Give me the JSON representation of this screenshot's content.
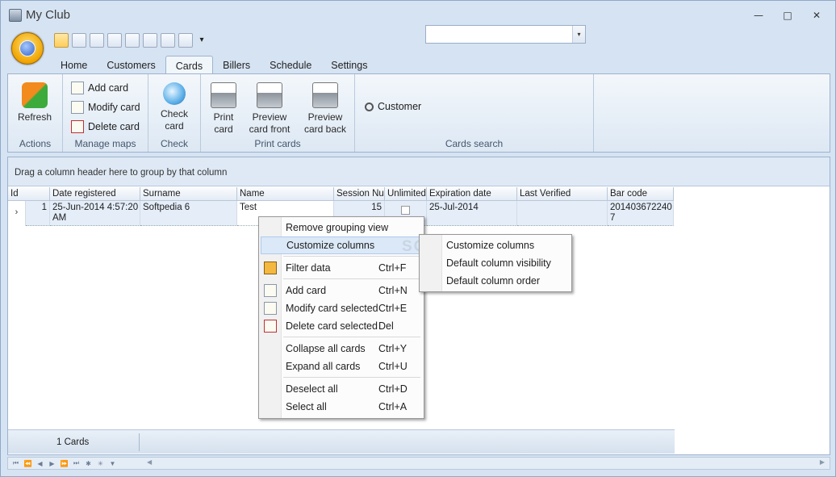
{
  "window": {
    "title": "My Club",
    "minimize": "—",
    "restore": "□",
    "close": "✕"
  },
  "qat_more": "▾",
  "tabs": [
    "Home",
    "Customers",
    "Cards",
    "Billers",
    "Schedule",
    "Settings"
  ],
  "ribbon": {
    "actions": {
      "refresh": "Refresh",
      "label": "Actions"
    },
    "manage_maps": {
      "add": "Add card",
      "modify": "Modify card",
      "delete": "Delete card",
      "label": "Manage maps"
    },
    "check": {
      "check_card_1": "Check",
      "check_card_2": "card",
      "label": "Check"
    },
    "print": {
      "print_1": "Print",
      "print_2": "card",
      "front_1": "Preview",
      "front_2": "card front",
      "back_1": "Preview",
      "back_2": "card back",
      "label": "Print cards"
    },
    "search": {
      "customer_label": "Customer",
      "customer_value": "",
      "dropdown": "▾",
      "label": "Cards search"
    }
  },
  "grid": {
    "group_hint": "Drag a column header here to group by that column",
    "columns": [
      "Id",
      "Date registered",
      "Surname",
      "Name",
      "Session Num",
      "Unlimited",
      "Expiration date",
      "Last Verified",
      "Bar code"
    ],
    "row": {
      "indicator": "›",
      "id": "1",
      "date": "25-Jun-2014 4:57:20 AM",
      "surname": "Softpedia 6",
      "name": "Test",
      "session": "15",
      "expiration": "25-Jul-2014",
      "last_verified": "",
      "barcode": "2014036722407"
    },
    "footer_count": "1 Cards"
  },
  "nav": [
    "⏮",
    "⏪",
    "◀",
    "▶",
    "⏩",
    "⏭",
    "✱",
    "✳",
    "▼"
  ],
  "scroll": {
    "left": "◀",
    "right": "▶"
  },
  "context_menu": [
    {
      "label": "Remove grouping view",
      "shortcut": ""
    },
    {
      "label": "Customize columns",
      "shortcut": ""
    },
    {
      "label": "Filter data",
      "shortcut": "Ctrl+F"
    },
    {
      "label": "Add card",
      "shortcut": "Ctrl+N"
    },
    {
      "label": "Modify card selected",
      "shortcut": "Ctrl+E"
    },
    {
      "label": "Delete card selected",
      "shortcut": "Del"
    },
    {
      "label": "Collapse all cards",
      "shortcut": "Ctrl+Y"
    },
    {
      "label": "Expand all cards",
      "shortcut": "Ctrl+U"
    },
    {
      "label": "Deselect all",
      "shortcut": "Ctrl+D"
    },
    {
      "label": "Select all",
      "shortcut": "Ctrl+A"
    }
  ],
  "submenu": [
    "Customize columns",
    "Default column visibility",
    "Default column order"
  ],
  "watermark": "SOFTPEDIA",
  "colors": {
    "accent": "#f0a400",
    "selection": "#dbe8f7",
    "ribbon": "#dde8f4"
  }
}
